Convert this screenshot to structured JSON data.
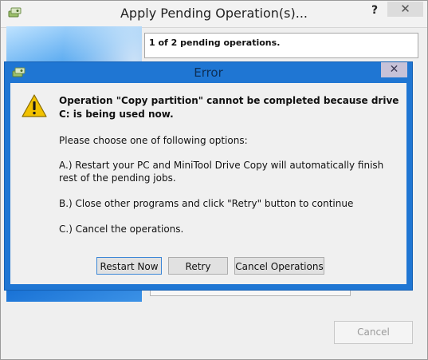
{
  "background_dialog": {
    "title": "Apply Pending Operation(s)...",
    "help_glyph": "?",
    "close_glyph": "✕",
    "pending_status": "1 of 2 pending operations.",
    "cancel_label": "Cancel"
  },
  "error_dialog": {
    "title": "Error",
    "close_glyph": "✕",
    "heading": "Operation \"Copy partition\" cannot be completed because drive C: is being used now.",
    "prompt": "Please choose one of following options:",
    "option_a": "A.) Restart your PC and MiniTool Drive Copy will automatically finish rest of the pending jobs.",
    "option_b": "B.) Close other programs and click \"Retry\" button to continue",
    "option_c": "C.) Cancel the operations.",
    "buttons": {
      "restart_now": "Restart Now",
      "retry": "Retry",
      "cancel_operations": "Cancel Operations"
    }
  },
  "colors": {
    "error_frame": "#1f76d3",
    "dialog_bg": "#f0f0f0",
    "warning_yellow": "#f2c200"
  },
  "icons": {
    "app_icon": "minitool-app-icon",
    "warning_icon": "warning-triangle-icon"
  }
}
